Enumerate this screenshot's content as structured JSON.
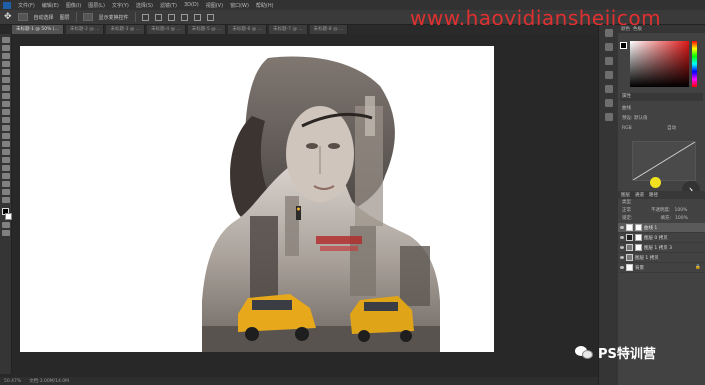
{
  "menubar": {
    "items": [
      "文件(F)",
      "编辑(E)",
      "图像(I)",
      "图层(L)",
      "文字(Y)",
      "选择(S)",
      "滤镜(T)",
      "3D(D)",
      "视图(V)",
      "窗口(W)",
      "帮助(H)"
    ]
  },
  "options": {
    "auto_select_label": "自动选择",
    "layer_label": "图层",
    "transform_label": "显示变换控件"
  },
  "watermark": "www.haoyidianshejicom",
  "tabs": [
    {
      "label": "未标题-1 @ 50% (...",
      "active": true
    },
    {
      "label": "未标题-2 @ ...",
      "active": false
    },
    {
      "label": "未标题-3 @ ...",
      "active": false
    },
    {
      "label": "未标题-4 @ ...",
      "active": false
    },
    {
      "label": "未标题-5 @ ...",
      "active": false
    },
    {
      "label": "未标题-6 @ ...",
      "active": false
    },
    {
      "label": "未标题-7 @ ...",
      "active": false
    },
    {
      "label": "未标题-8 @ ...",
      "active": false
    }
  ],
  "status": {
    "zoom": "50.47%",
    "doc": "文档:3.00M/14.0M"
  },
  "panel": {
    "color_tabs": [
      "颜色",
      "色板"
    ],
    "properties_title": "属性",
    "curves_label": "曲线",
    "preset_label": "预设:",
    "preset_value": "默认值",
    "channel_label": "RGB",
    "auto_label": "自动"
  },
  "layers": {
    "tabs": [
      "图层",
      "通道",
      "路径"
    ],
    "kind_label": "类型",
    "blend_mode": "正常",
    "opacity_label": "不透明度:",
    "opacity_value": "100%",
    "lock_label": "锁定:",
    "fill_label": "填充:",
    "fill_value": "100%",
    "items": [
      {
        "name": "曲线 1",
        "thumb": "white",
        "mask": true,
        "selected": true
      },
      {
        "name": "图层 0 拷贝",
        "thumb": "dark",
        "mask": true,
        "selected": false
      },
      {
        "name": "图层 1 拷贝 3",
        "thumb": "photo",
        "mask": true,
        "selected": false
      },
      {
        "name": "图层 1 拷贝",
        "thumb": "photo",
        "mask": false,
        "selected": false
      },
      {
        "name": "背景",
        "thumb": "white",
        "mask": false,
        "selected": false
      }
    ]
  },
  "branding": {
    "text": "PS特训营"
  },
  "colors": {
    "accent_red": "#e01818",
    "watermark_red": "#e03030",
    "cursor_yellow": "#f0e020"
  }
}
